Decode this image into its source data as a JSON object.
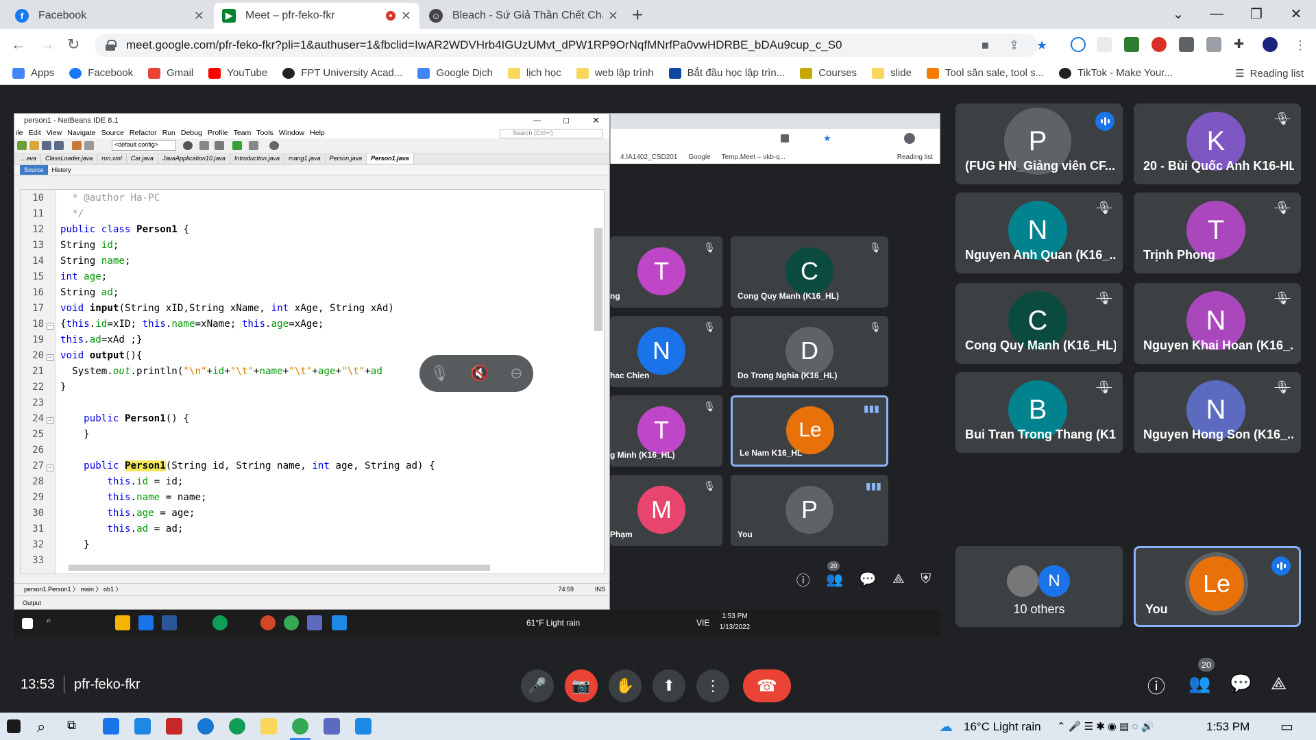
{
  "browser": {
    "tabs": [
      {
        "title": "Facebook"
      },
      {
        "title": "Meet – pfr-feko-fkr"
      },
      {
        "title": "Bleach - Sứ Giả Thần Chết Chap"
      }
    ],
    "url": "meet.google.com/pfr-feko-fkr?pli=1&authuser=1&fbclid=IwAR2WDVHrb4IGUzUMvt_dPW1RP9OrNqfMNrfPa0vwHDRBE_bDAu9cup_c_S0",
    "bookmarks": [
      "Apps",
      "Facebook",
      "Gmail",
      "YouTube",
      "FPT University Acad...",
      "Google Dịch",
      "lịch học",
      "web lập trình",
      "Bắt đầu học lập trìn...",
      "Courses",
      "slide",
      "Tool săn sale, tool s...",
      "TikTok - Make Your..."
    ],
    "reading_list": "Reading list",
    "colors": {
      "accent": "#1a73e8",
      "end_call": "#ea4335"
    }
  },
  "netbeans": {
    "title": "person1 - NetBeans IDE 8.1",
    "menu": [
      "ile",
      "Edit",
      "View",
      "Navigate",
      "Source",
      "Refactor",
      "Run",
      "Debug",
      "Profile",
      "Team",
      "Tools",
      "Window",
      "Help"
    ],
    "search_placeholder": "Search (Ctrl+I)",
    "config": "<default config>",
    "file_tabs": [
      "...ava",
      "ClassLoader.java",
      "run.xml",
      "Car.java",
      "JavaApplication10.java",
      "Introduction.java",
      "mang1.java",
      "Person.java",
      "Person1.java"
    ],
    "source_tab": "Source",
    "history_tab": "History",
    "lines": [
      {
        "n": "10",
        "html": "<span class='cm'>  * @author Ha-PC</span>"
      },
      {
        "n": "11",
        "html": "<span class='cm'>  */</span>"
      },
      {
        "n": "12",
        "html": "<span class='kw'>public class</span> <span class='b'>Person1</span> {"
      },
      {
        "n": "13",
        "html": "String <span class='fld'>id</span>;"
      },
      {
        "n": "14",
        "html": "String <span class='fld'>name</span>;"
      },
      {
        "n": "15",
        "html": "<span class='kw'>int</span> <span class='fld'>age</span>;"
      },
      {
        "n": "16",
        "html": "String <span class='fld'>ad</span>;"
      },
      {
        "n": "17",
        "html": "<span class='kw'>void</span> <span class='b'>input</span>(String xID,String xName, <span class='kw'>int</span> xAge, String xAd)"
      },
      {
        "n": "18",
        "html": "{<span class='kw'>this</span>.<span class='fld'>id</span>=xID; <span class='kw'>this</span>.<span class='fld'>name</span>=xName; <span class='kw'>this</span>.<span class='fld'>age</span>=xAge;"
      },
      {
        "n": "19",
        "html": "<span class='kw'>this</span>.<span class='fld'>ad</span>=xAd ;}"
      },
      {
        "n": "20",
        "html": "<span class='kw'>void</span> <span class='b'>output</span>(){"
      },
      {
        "n": "21",
        "html": "  System.<span class='fld it'>out</span>.println(<span class='str'>\"\\n\"</span>+<span class='fld'>id</span>+<span class='str'>\"\\t\"</span>+<span class='fld'>name</span>+<span class='str'>\"\\t\"</span>+<span class='fld'>age</span>+<span class='str'>\"\\t\"</span>+<span class='fld'>ad</span>"
      },
      {
        "n": "22",
        "html": "}"
      },
      {
        "n": "23",
        "html": ""
      },
      {
        "n": "24",
        "html": "    <span class='kw'>public</span> <span class='b'>Person1</span>() {"
      },
      {
        "n": "25",
        "html": "    }"
      },
      {
        "n": "26",
        "html": ""
      },
      {
        "n": "27",
        "html": "    <span class='kw'>public</span> <span class='b hl'>Person1</span>(String id, String name, <span class='kw'>int</span> age, String ad) {"
      },
      {
        "n": "28",
        "html": "        <span class='kw'>this</span>.<span class='fld'>id</span> = id;"
      },
      {
        "n": "29",
        "html": "        <span class='kw'>this</span>.<span class='fld'>name</span> = name;"
      },
      {
        "n": "30",
        "html": "        <span class='kw'>this</span>.<span class='fld'>age</span> = age;"
      },
      {
        "n": "31",
        "html": "        <span class='kw'>this</span>.<span class='fld'>ad</span> = ad;"
      },
      {
        "n": "32",
        "html": "    }"
      },
      {
        "n": "33",
        "html": ""
      }
    ],
    "breadcrumb": "person1.Person1 〉 main 〉 ob1 〉",
    "cursor_pos": "74:59",
    "ins": "INS",
    "output_tab": "Output"
  },
  "shared_browser": {
    "bookmarks": [
      "4.IA1402_CSD201",
      "Google",
      "Temp.Meet – vkb-q...",
      "Reading list"
    ]
  },
  "shared_tiles": [
    {
      "initial": "T",
      "name": "ng",
      "color": "#c046c8"
    },
    {
      "initial": "C",
      "name": "Cong Quy Manh (K16_HL)",
      "color": "#0b4a3f"
    },
    {
      "initial": "N",
      "name": "hac Chien",
      "color": "#1a73e8"
    },
    {
      "initial": "D",
      "name": "Do Trong Nghia (K16_HL)",
      "color": "#5f6368"
    },
    {
      "initial": "T",
      "name": "g Minh (K16_HL)",
      "color": "#c046c8"
    },
    {
      "initial": "Le",
      "name": "Le Nam K16_HL",
      "color": "#e8710a"
    },
    {
      "initial": "M",
      "name": "Phạm",
      "color": "#e8466e"
    },
    {
      "initial": "P",
      "name": "You",
      "color": "#5f6368"
    }
  ],
  "shared_people_count": "20",
  "inner_taskbar": {
    "weather": "61°F  Light rain",
    "lang": "VIE",
    "time": "1:53 PM",
    "date": "1/13/2022"
  },
  "participants": [
    {
      "initial": "P",
      "name": "(FUG HN_Giảng viên CF...",
      "color": "#5f6368",
      "speaking": true
    },
    {
      "initial": "K",
      "name": "20 - Bùi Quốc Anh K16-HL",
      "color": "#7e57c2",
      "speaking": false
    },
    {
      "initial": "N",
      "name": "Nguyen Anh Quan (K16_...",
      "color": "#00838f",
      "speaking": false
    },
    {
      "initial": "T",
      "name": "Trịnh Phong",
      "color": "#ab47bc",
      "speaking": false
    },
    {
      "initial": "C",
      "name": "Cong Quy Manh (K16_HL)",
      "color": "#0b4a3f",
      "speaking": false
    },
    {
      "initial": "N",
      "name": "Nguyen Khai Hoan (K16_...",
      "color": "#ab47bc",
      "speaking": false
    },
    {
      "initial": "B",
      "name": "Bui Tran Trong Thang (K1...",
      "color": "#00838f",
      "speaking": false
    },
    {
      "initial": "N",
      "name": "Nguyen Hong Son (K16_...",
      "color": "#5c6bc0",
      "speaking": false
    }
  ],
  "others": {
    "initial": "N",
    "label": "10 others"
  },
  "you_tile": {
    "initial": "Le",
    "name": "You",
    "color": "#e8710a"
  },
  "meeting": {
    "time": "13:53",
    "code": "pfr-feko-fkr",
    "people_count": "20"
  },
  "taskbar": {
    "weather": "16°C  Light rain",
    "time": "1:53 PM"
  }
}
